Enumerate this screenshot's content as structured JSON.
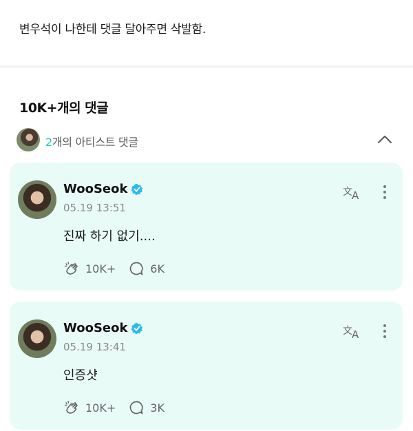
{
  "post": {
    "text": "변우석이 나한테 댓글 달아주면 삭발함."
  },
  "comments_header": {
    "title": "10K+개의 댓글"
  },
  "artist_section": {
    "count": "2",
    "label": "개의 아티스트 댓글",
    "icon": "chevron-up-icon"
  },
  "comments": [
    {
      "author": "WooSeok",
      "verified": true,
      "time": "05.19 13:51",
      "text": "진짜 하기 없기....",
      "reactions": "10K+",
      "replies": "6K"
    },
    {
      "author": "WooSeok",
      "verified": true,
      "time": "05.19 13:41",
      "text": "인증샷",
      "reactions": "10K+",
      "replies": "3K"
    }
  ],
  "colors": {
    "accent": "#27c6b6",
    "card_bg": "#e8fbf7",
    "verified": "#2fb9ee"
  }
}
